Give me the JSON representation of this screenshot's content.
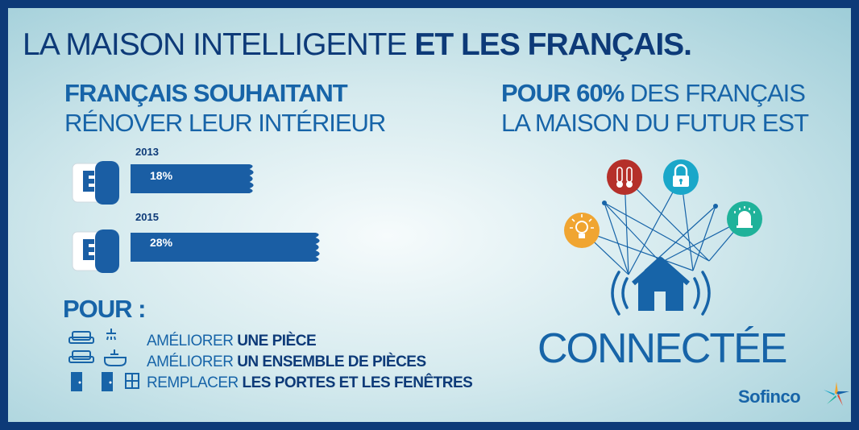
{
  "title": {
    "light": "LA MAISON INTELLIGENTE ",
    "bold": "ET LES FRANÇAIS."
  },
  "left": {
    "heading_bold": "FRANÇAIS SOUHAITANT",
    "heading_light": "RÉNOVER LEUR INTÉRIEUR",
    "bars": [
      {
        "year": "2013",
        "label": "18%",
        "value": 18
      },
      {
        "year": "2015",
        "label": "28%",
        "value": 28
      }
    ],
    "pour_label": "POUR :",
    "reasons": [
      {
        "light": "AMÉLIORER ",
        "bold": "UNE PIÈCE"
      },
      {
        "light": "AMÉLIORER ",
        "bold": "UN ENSEMBLE DE PIÈCES"
      },
      {
        "light": "REMPLACER ",
        "bold": "LES PORTES ET LES FENÊTRES"
      }
    ]
  },
  "right": {
    "heading_bold": "POUR 60%",
    "heading_rest": " DES FRANÇAIS",
    "heading_line2": "LA MAISON DU FUTUR EST",
    "connected_label": "CONNECTÉE",
    "icons": [
      "lightbulb-icon",
      "thermometer-icon",
      "lock-icon",
      "sprinkler-icon",
      "connected-house-icon"
    ]
  },
  "brand": "Sofinco",
  "colors": {
    "frame": "#0d3a78",
    "primary": "#1764a8",
    "bar": "#1a5ea4",
    "red": "#b5302a",
    "teal": "#1aa7c9",
    "orange": "#f0a531",
    "green": "#1fb29a"
  }
}
